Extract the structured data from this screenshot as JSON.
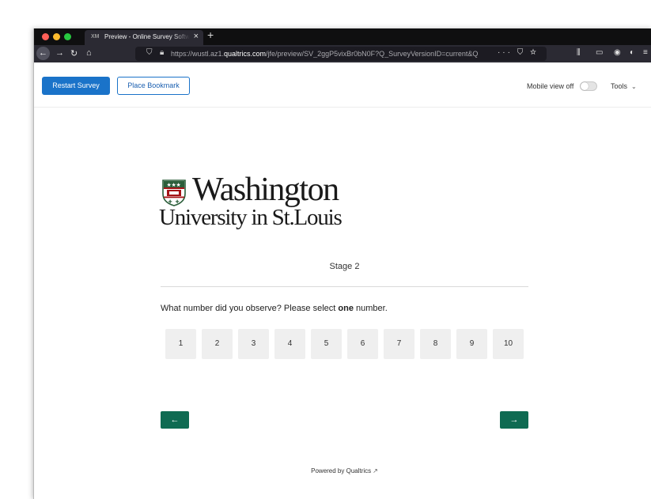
{
  "browser": {
    "tab_title": "Preview - Online Survey Software",
    "tab_favicon": "XM",
    "url_prefix": "https://wustl.az1.",
    "url_domain": "qualtrics.com",
    "url_suffix": "/jfe/preview/SV_2ggP5vixBr0bN0F?Q_SurveyVersionID=current&Q"
  },
  "survey_toolbar": {
    "restart_label": "Restart Survey",
    "bookmark_label": "Place Bookmark",
    "mobile_view_label": "Mobile view off",
    "tools_label": "Tools"
  },
  "logo": {
    "main": "Washington",
    "sub": "University in St.Louis"
  },
  "survey": {
    "stage_label": "Stage 2",
    "question_prefix": "What number did you observe? Please select ",
    "question_bold": "one",
    "question_suffix": " number.",
    "options": [
      "1",
      "2",
      "3",
      "4",
      "5",
      "6",
      "7",
      "8",
      "9",
      "10"
    ],
    "prev_label": "←",
    "next_label": "→",
    "powered_by": "Powered by Qualtrics"
  },
  "colors": {
    "primary_button": "#1a73c9",
    "nav_button": "#0f6b52",
    "wustl_red": "#a51417",
    "wustl_green": "#2b5e3a"
  }
}
